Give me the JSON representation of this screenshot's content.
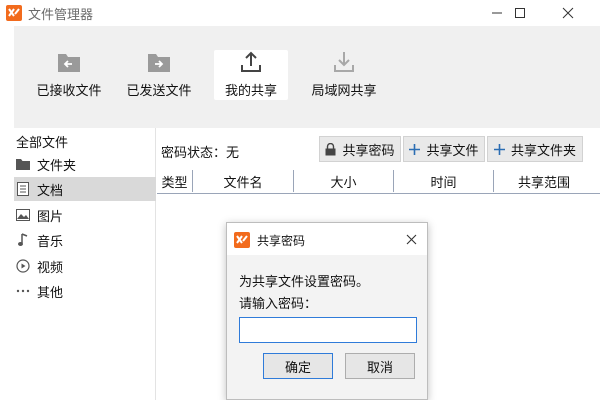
{
  "window": {
    "title": "文件管理器"
  },
  "toolbar": {
    "items": [
      {
        "label": "已接收文件",
        "icon": "received-folder-icon"
      },
      {
        "label": "已发送文件",
        "icon": "sent-folder-icon"
      },
      {
        "label": "我的共享",
        "icon": "upload-share-icon",
        "active": true
      },
      {
        "label": "局域网共享",
        "icon": "download-lan-icon",
        "disabled": true
      }
    ]
  },
  "sidebar": {
    "header": "全部文件",
    "items": [
      {
        "label": "文件夹",
        "icon": "folder-icon"
      },
      {
        "label": "文档",
        "icon": "document-icon",
        "active": true
      },
      {
        "label": "图片",
        "icon": "image-icon"
      },
      {
        "label": "音乐",
        "icon": "music-note-icon"
      },
      {
        "label": "视频",
        "icon": "video-play-icon"
      },
      {
        "label": "其他",
        "icon": "ellipsis-icon"
      }
    ]
  },
  "main": {
    "password_status": "密码状态：无",
    "actions": {
      "share_password": "共享密码",
      "share_file": "共享文件",
      "share_folder": "共享文件夹"
    },
    "columns": [
      "类型",
      "文件名",
      "大小",
      "时间",
      "共享范围"
    ]
  },
  "dialog": {
    "title": "共享密码",
    "message": "为共享文件设置密码。",
    "prompt": "请输入密码：",
    "input_value": "",
    "ok_label": "确定",
    "cancel_label": "取消"
  },
  "colors": {
    "logo_orange": "#f26b1d",
    "toolbar_bg": "#f0f0f0",
    "selected_row": "#d9d9d9",
    "focus_blue": "#2f7bd9"
  }
}
